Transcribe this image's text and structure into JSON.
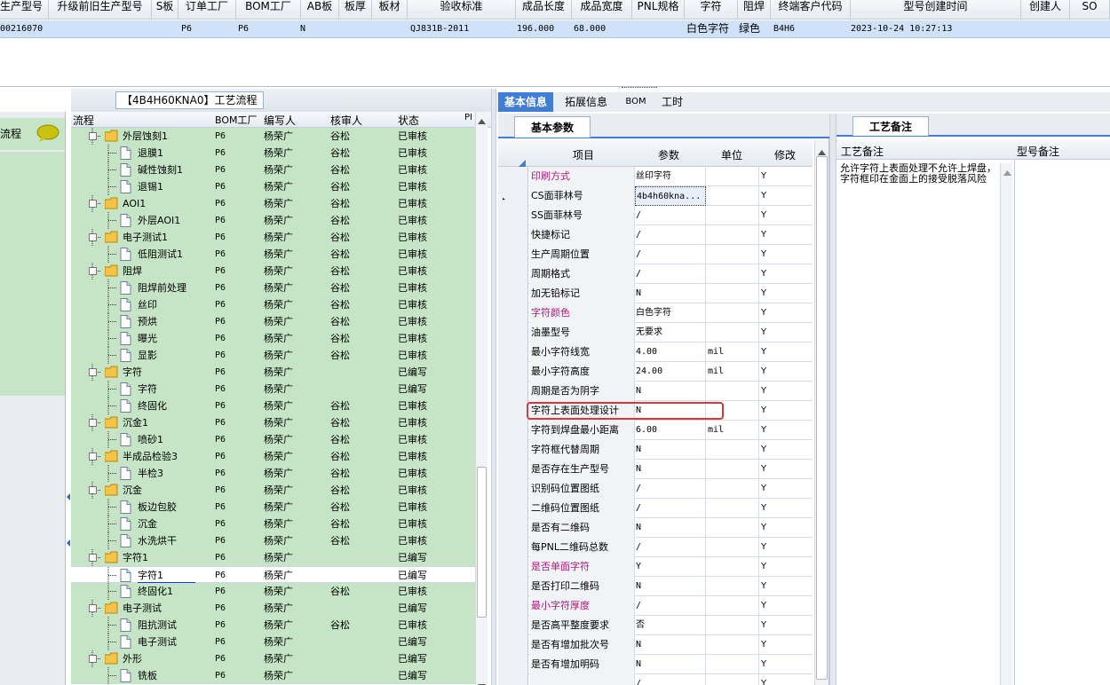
{
  "top_grid": {
    "headers": [
      "生产型号",
      "升级前旧生产型号",
      "S板",
      "订单工厂",
      "BOM工厂",
      "AB板",
      "板厚",
      "板材",
      "验收标准",
      "成品长度",
      "成品宽度",
      "PNL规格",
      "字符",
      "阻焊",
      "终端客户代码",
      "型号创建时间",
      "创建人",
      "SO"
    ],
    "row": [
      "00216070",
      "",
      "P6",
      "P6",
      "N",
      "",
      "",
      "",
      "QJ831B-2011",
      "196.000",
      "68.000",
      "",
      "白色字符",
      "绿色",
      "B4H6",
      "2023-10-24 10:27:13",
      "",
      ""
    ]
  },
  "left_nav": {
    "label": "流程"
  },
  "flow_panel": {
    "title": "【4B4H60KNA0】工艺流程",
    "headers": [
      "流程",
      "BOM工厂",
      "编写人",
      "核审人",
      "状态",
      "PI"
    ],
    "rows": [
      {
        "name": "外层蚀刻1",
        "level": 0,
        "bom": "P6",
        "writer": "杨荣广",
        "reviewer": "谷松",
        "status": "已审核"
      },
      {
        "name": "退膜1",
        "level": 1,
        "bom": "P6",
        "writer": "杨荣广",
        "reviewer": "谷松",
        "status": "已审核"
      },
      {
        "name": "碱性蚀刻1",
        "level": 1,
        "bom": "P6",
        "writer": "杨荣广",
        "reviewer": "谷松",
        "status": "已审核"
      },
      {
        "name": "退锡1",
        "level": 1,
        "bom": "P6",
        "writer": "杨荣广",
        "reviewer": "谷松",
        "status": "已审核"
      },
      {
        "name": "AOI1",
        "level": 0,
        "bom": "P6",
        "writer": "杨荣广",
        "reviewer": "谷松",
        "status": "已审核"
      },
      {
        "name": "外层AOI1",
        "level": 1,
        "bom": "P6",
        "writer": "杨荣广",
        "reviewer": "谷松",
        "status": "已审核"
      },
      {
        "name": "电子测试1",
        "level": 0,
        "bom": "P6",
        "writer": "杨荣广",
        "reviewer": "谷松",
        "status": "已审核"
      },
      {
        "name": "低阻测试1",
        "level": 1,
        "bom": "P6",
        "writer": "杨荣广",
        "reviewer": "谷松",
        "status": "已审核"
      },
      {
        "name": "阻焊",
        "level": 0,
        "bom": "P6",
        "writer": "杨荣广",
        "reviewer": "谷松",
        "status": "已审核"
      },
      {
        "name": "阻焊前处理",
        "level": 1,
        "bom": "P6",
        "writer": "杨荣广",
        "reviewer": "谷松",
        "status": "已审核"
      },
      {
        "name": "丝印",
        "level": 1,
        "bom": "P6",
        "writer": "杨荣广",
        "reviewer": "谷松",
        "status": "已审核"
      },
      {
        "name": "预烘",
        "level": 1,
        "bom": "P6",
        "writer": "杨荣广",
        "reviewer": "谷松",
        "status": "已审核"
      },
      {
        "name": "曝光",
        "level": 1,
        "bom": "P6",
        "writer": "杨荣广",
        "reviewer": "谷松",
        "status": "已审核"
      },
      {
        "name": "显影",
        "level": 1,
        "bom": "P6",
        "writer": "杨荣广",
        "reviewer": "谷松",
        "status": "已审核"
      },
      {
        "name": "字符",
        "level": 0,
        "bom": "P6",
        "writer": "杨荣广",
        "reviewer": "",
        "status": "已编写"
      },
      {
        "name": "字符",
        "level": 1,
        "bom": "P6",
        "writer": "杨荣广",
        "reviewer": "",
        "status": "已编写"
      },
      {
        "name": "终固化",
        "level": 1,
        "bom": "P6",
        "writer": "杨荣广",
        "reviewer": "谷松",
        "status": "已审核"
      },
      {
        "name": "沉金1",
        "level": 0,
        "bom": "P6",
        "writer": "杨荣广",
        "reviewer": "谷松",
        "status": "已审核"
      },
      {
        "name": "喷砂1",
        "level": 1,
        "bom": "P6",
        "writer": "杨荣广",
        "reviewer": "谷松",
        "status": "已审核"
      },
      {
        "name": "半成品检验3",
        "level": 0,
        "bom": "P6",
        "writer": "杨荣广",
        "reviewer": "谷松",
        "status": "已审核"
      },
      {
        "name": "半检3",
        "level": 1,
        "bom": "P6",
        "writer": "杨荣广",
        "reviewer": "谷松",
        "status": "已审核"
      },
      {
        "name": "沉金",
        "level": 0,
        "bom": "P6",
        "writer": "杨荣广",
        "reviewer": "谷松",
        "status": "已审核"
      },
      {
        "name": "板边包胶",
        "level": 1,
        "bom": "P6",
        "writer": "杨荣广",
        "reviewer": "谷松",
        "status": "已审核"
      },
      {
        "name": "沉金",
        "level": 1,
        "bom": "P6",
        "writer": "杨荣广",
        "reviewer": "谷松",
        "status": "已审核"
      },
      {
        "name": "水洗烘干",
        "level": 1,
        "bom": "P6",
        "writer": "杨荣广",
        "reviewer": "谷松",
        "status": "已审核"
      },
      {
        "name": "字符1",
        "level": 0,
        "bom": "P6",
        "writer": "杨荣广",
        "reviewer": "",
        "status": "已编写"
      },
      {
        "name": "字符1",
        "level": 1,
        "bom": "P6",
        "writer": "杨荣广",
        "reviewer": "",
        "status": "已编写",
        "selected": true
      },
      {
        "name": "终固化1",
        "level": 1,
        "bom": "P6",
        "writer": "杨荣广",
        "reviewer": "谷松",
        "status": "已审核"
      },
      {
        "name": "电子测试",
        "level": 0,
        "bom": "P6",
        "writer": "杨荣广",
        "reviewer": "",
        "status": "已编写"
      },
      {
        "name": "阻抗测试",
        "level": 1,
        "bom": "P6",
        "writer": "杨荣广",
        "reviewer": "谷松",
        "status": "已审核"
      },
      {
        "name": "电子测试",
        "level": 1,
        "bom": "P6",
        "writer": "杨荣广",
        "reviewer": "",
        "status": "已编写"
      },
      {
        "name": "外形",
        "level": 0,
        "bom": "P6",
        "writer": "杨荣广",
        "reviewer": "",
        "status": "已编写"
      },
      {
        "name": "铣板",
        "level": 1,
        "bom": "P6",
        "writer": "杨荣广",
        "reviewer": "",
        "status": "已编写"
      }
    ]
  },
  "tabs": [
    "基本信息",
    "拓展信息",
    "BOM",
    "工时"
  ],
  "params_panel": {
    "tab": "基本参数",
    "headers": [
      "项目",
      "参数",
      "单位",
      "修改"
    ],
    "rows": [
      {
        "item": "印刷方式",
        "value": "丝印字符",
        "unit": "",
        "edit": "Y",
        "magenta": true
      },
      {
        "item": "CS面菲林号",
        "value": "4b4h60kna...",
        "unit": "",
        "edit": "Y",
        "current": true
      },
      {
        "item": "SS面菲林号",
        "value": "/",
        "unit": "",
        "edit": "Y"
      },
      {
        "item": "快捷标记",
        "value": "/",
        "unit": "",
        "edit": "Y"
      },
      {
        "item": "生产周期位置",
        "value": "/",
        "unit": "",
        "edit": "Y"
      },
      {
        "item": "周期格式",
        "value": "/",
        "unit": "",
        "edit": "Y"
      },
      {
        "item": "加无铅标记",
        "value": "N",
        "unit": "",
        "edit": "Y"
      },
      {
        "item": "字符颜色",
        "value": "白色字符",
        "unit": "",
        "edit": "Y",
        "magenta": true
      },
      {
        "item": "油墨型号",
        "value": "无要求",
        "unit": "",
        "edit": "Y"
      },
      {
        "item": "最小字符线宽",
        "value": "4.00",
        "unit": "mil",
        "edit": "Y"
      },
      {
        "item": "最小字符高度",
        "value": "24.00",
        "unit": "mil",
        "edit": "Y"
      },
      {
        "item": "周期是否为阴字",
        "value": "N",
        "unit": "",
        "edit": "Y"
      },
      {
        "item": "字符上表面处理设计",
        "value": "N",
        "unit": "",
        "edit": "Y",
        "highlight": true
      },
      {
        "item": "字符到焊盘最小距离",
        "value": "6.00",
        "unit": "mil",
        "edit": "Y"
      },
      {
        "item": "字符框代替周期",
        "value": "N",
        "unit": "",
        "edit": "Y"
      },
      {
        "item": "是否存在生产型号",
        "value": "N",
        "unit": "",
        "edit": "Y"
      },
      {
        "item": "识别码位置图纸",
        "value": "/",
        "unit": "",
        "edit": "Y"
      },
      {
        "item": "二维码位置图纸",
        "value": "/",
        "unit": "",
        "edit": "Y"
      },
      {
        "item": "是否有二维码",
        "value": "N",
        "unit": "",
        "edit": "Y"
      },
      {
        "item": "每PNL二维码总数",
        "value": "/",
        "unit": "",
        "edit": "Y"
      },
      {
        "item": "是否单面字符",
        "value": "Y",
        "unit": "",
        "edit": "Y",
        "magenta": true
      },
      {
        "item": "是否打印二维码",
        "value": "N",
        "unit": "",
        "edit": "Y"
      },
      {
        "item": "最小字符厚度",
        "value": "/",
        "unit": "",
        "edit": "Y",
        "magenta": true
      },
      {
        "item": "是否高平整度要求",
        "value": "否",
        "unit": "",
        "edit": "Y"
      },
      {
        "item": "是否有增加批次号",
        "value": "N",
        "unit": "",
        "edit": "Y"
      },
      {
        "item": "是否有增加明码",
        "value": "N",
        "unit": "",
        "edit": "Y"
      },
      {
        "item": "",
        "value": "/",
        "unit": "",
        "edit": "Y"
      }
    ]
  },
  "remark_panel": {
    "tab": "工艺备注",
    "headers": [
      "工艺备注",
      "型号备注"
    ],
    "text": "允许字符上表面处理不允许上焊盘，字符框印在金面上的接受脱落风险"
  },
  "colors": {
    "row_green": "#c6e5c6",
    "selection": "#cfe2f8",
    "magenta": "#b0177a",
    "highlight_border": "#d83838"
  }
}
